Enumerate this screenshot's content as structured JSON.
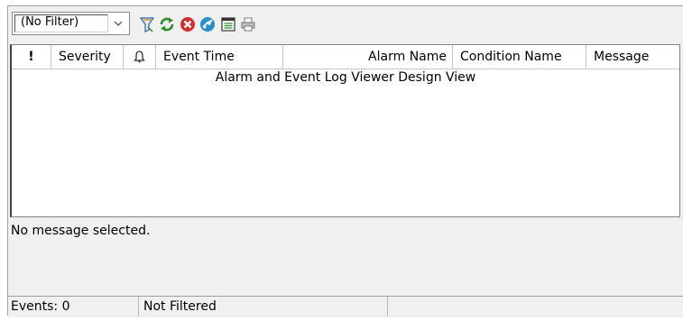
{
  "toolbar": {
    "filter_value": "(No Filter)",
    "icons": [
      "filter-icon",
      "refresh-icon",
      "stop-icon",
      "connect-icon",
      "log-icon",
      "print-icon"
    ],
    "colors": {
      "refresh": "#2e8b2e",
      "stop": "#d32f2f",
      "connect": "#2a8ec8",
      "filter": "#2e5fa8"
    }
  },
  "grid": {
    "columns": [
      {
        "label": "!"
      },
      {
        "label": "Severity"
      },
      {
        "label": "🔔"
      },
      {
        "label": "Event Time"
      },
      {
        "label": "Alarm Name"
      },
      {
        "label": "Condition Name"
      },
      {
        "label": "Message"
      }
    ],
    "design_view_label": "Alarm and Event Log Viewer Design View"
  },
  "message_pane": {
    "text": "No message selected."
  },
  "status_bar": {
    "events": "Events: 0",
    "filter_status": "Not Filtered"
  }
}
